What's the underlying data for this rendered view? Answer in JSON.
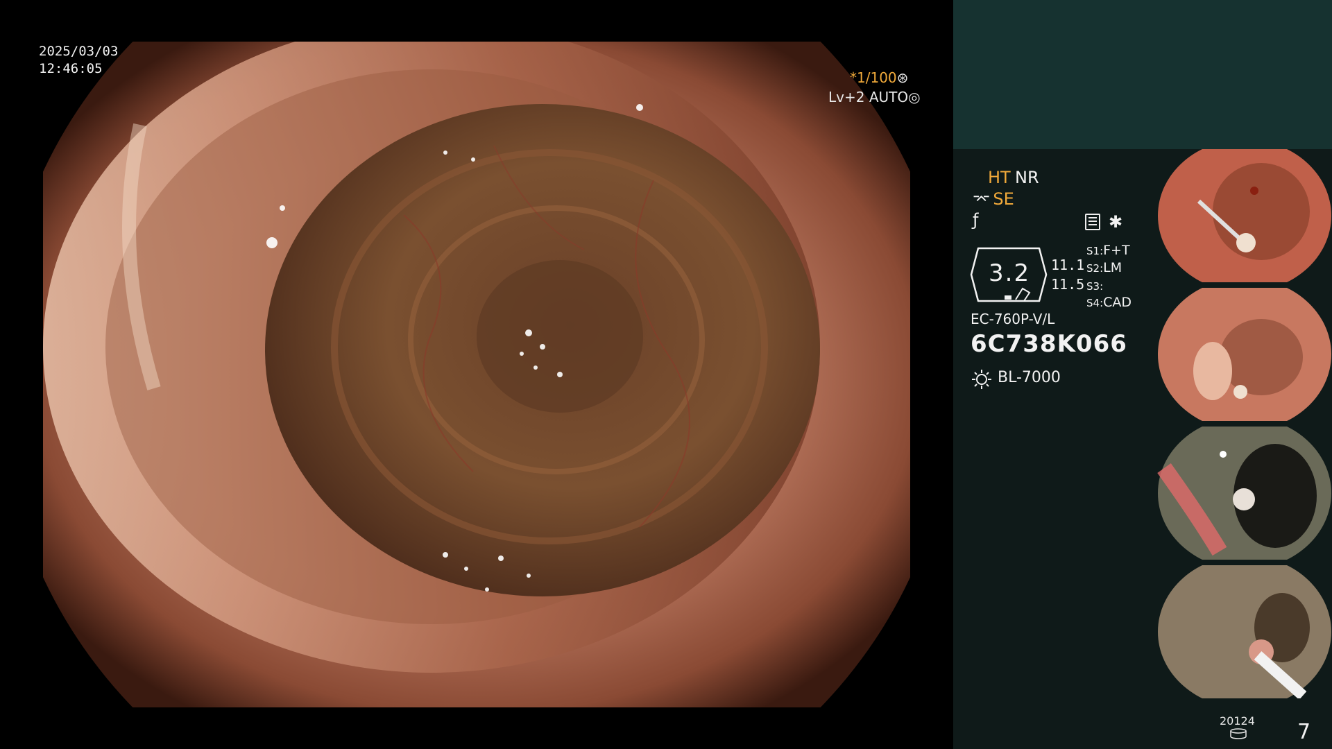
{
  "overlay": {
    "date": "2025/03/03",
    "time": "12:46:05",
    "shutter_speed": "*1/100",
    "level": "Lv+2 AUTO"
  },
  "panel": {
    "ht": "HT",
    "nr": "NR",
    "se": "SE",
    "zoom": "3.2",
    "value_top": "11.1",
    "value_bottom": "11.5",
    "switches": {
      "s1_label": "S1:",
      "s1_value": "F+T",
      "s2_label": "S2:",
      "s2_value": "LM",
      "s3_label": "S3:",
      "s3_value": "",
      "s4_label": "S4:",
      "s4_value": "CAD"
    },
    "scope_model": "EC-760P-V/L",
    "scope_serial": "6C738K066",
    "light_source": "BL-7000"
  },
  "footer": {
    "counter_label": "20124",
    "image_count": "7"
  },
  "icons": [
    "shutter-icon",
    "auto-icon",
    "se-scope-icon",
    "f-icon",
    "menu-icon",
    "star-icon",
    "sun-icon",
    "database-icon"
  ],
  "colors": {
    "accent": "#f0a93a",
    "panel_top": "#163230",
    "panel": "#0f1a19"
  }
}
